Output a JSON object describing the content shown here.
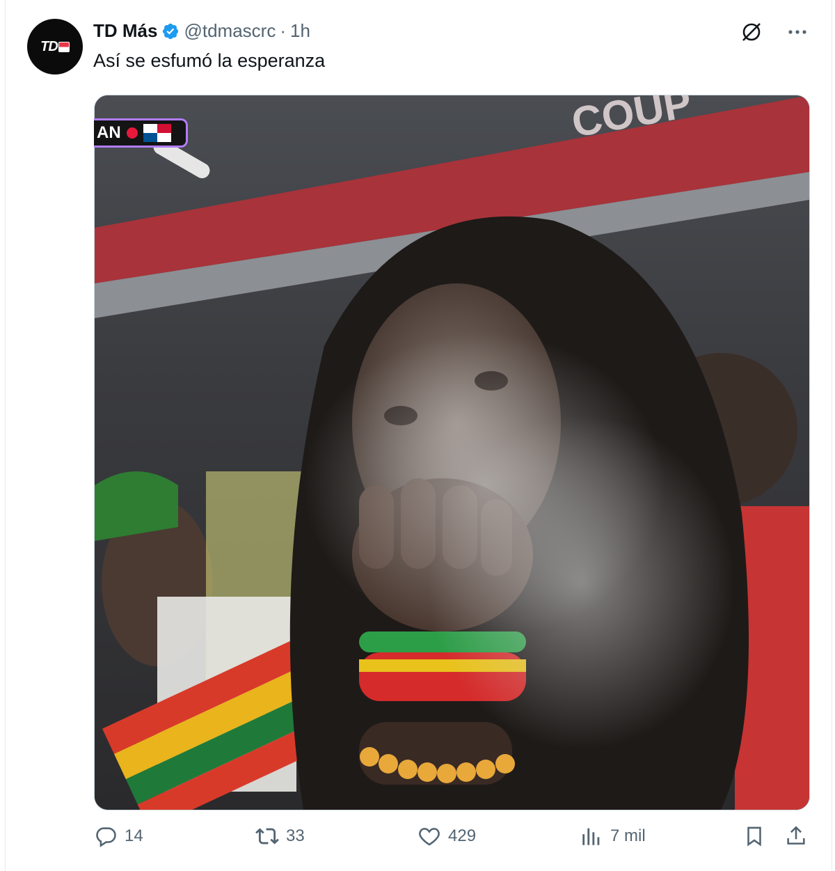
{
  "tweet": {
    "author_name": "TD Más",
    "handle": "@tdmascrc",
    "separator": "·",
    "time": "1h",
    "text": "Así se esfumó la esperanza",
    "avatar_logo": "TD"
  },
  "media": {
    "live_badge_text": "AN"
  },
  "actions": {
    "replies": "14",
    "reposts": "33",
    "likes": "429",
    "views": "7 mil"
  },
  "colors": {
    "accent": "#1d9bf0",
    "secondary_text": "#536471"
  }
}
